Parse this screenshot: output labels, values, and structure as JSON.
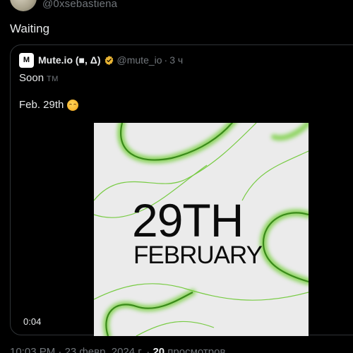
{
  "author": {
    "handle": "@0xsebastiena"
  },
  "tweet": {
    "text": "Waiting"
  },
  "quote": {
    "avatar_letter": "M",
    "name": "Mute.io (■, Δ)",
    "badge_icon": "verified-badge-icon",
    "badge_color": "#e9b434",
    "handle": "@mute_io",
    "dot": "·",
    "time": "3 ч",
    "line1": "Soon",
    "tm": "TM",
    "line2": "Feb. 29th",
    "emoji": "shushing-face-icon"
  },
  "media": {
    "date_text": "29TH",
    "month_text": "FEBRUARY",
    "duration": "0:04",
    "accent_color": "#6cc832",
    "background_color": "#ebebeb"
  },
  "footer": {
    "time": "10:03 PM",
    "sep": "·",
    "date": "23 февр. 2024 г.",
    "views_count": "20",
    "views_label": "просмотров"
  }
}
